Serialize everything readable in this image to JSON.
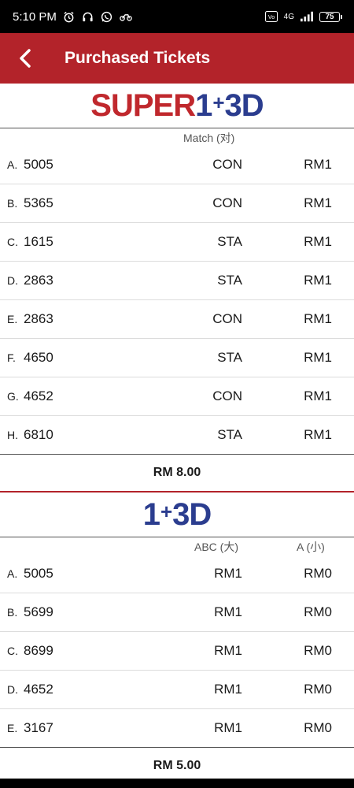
{
  "status_bar": {
    "time": "5:10 PM",
    "network": "4G",
    "battery": "75",
    "icons": [
      "alarm-icon",
      "headset-icon",
      "whatsapp-icon",
      "bike-icon",
      "volte-icon",
      "signal-icon"
    ]
  },
  "app_bar": {
    "title": "Purchased Tickets",
    "back_icon": "chevron-left-icon"
  },
  "super_section": {
    "logo": {
      "super": "SUPER",
      "one": "1",
      "plus": "+",
      "three_d": "3D"
    },
    "header": {
      "match": "Match (对)"
    },
    "rows": [
      {
        "letter": "A.",
        "number": "5005",
        "bet": "CON",
        "amount": "RM1"
      },
      {
        "letter": "B.",
        "number": "5365",
        "bet": "CON",
        "amount": "RM1"
      },
      {
        "letter": "C.",
        "number": "1615",
        "bet": "STA",
        "amount": "RM1"
      },
      {
        "letter": "D.",
        "number": "2863",
        "bet": "STA",
        "amount": "RM1"
      },
      {
        "letter": "E.",
        "number": "2863",
        "bet": "CON",
        "amount": "RM1"
      },
      {
        "letter": "F.",
        "number": "4650",
        "bet": "STA",
        "amount": "RM1"
      },
      {
        "letter": "G.",
        "number": "4652",
        "bet": "CON",
        "amount": "RM1"
      },
      {
        "letter": "H.",
        "number": "6810",
        "bet": "STA",
        "amount": "RM1"
      }
    ],
    "total": "RM 8.00"
  },
  "plain_section": {
    "logo": {
      "one": "1",
      "plus": "+",
      "three_d": "3D"
    },
    "header": {
      "abc": "ABC (大)",
      "a": "A (小)"
    },
    "rows": [
      {
        "letter": "A.",
        "number": "5005",
        "abc": "RM1",
        "a": "RM0"
      },
      {
        "letter": "B.",
        "number": "5699",
        "abc": "RM1",
        "a": "RM0"
      },
      {
        "letter": "C.",
        "number": "8699",
        "abc": "RM1",
        "a": "RM0"
      },
      {
        "letter": "D.",
        "number": "4652",
        "abc": "RM1",
        "a": "RM0"
      },
      {
        "letter": "E.",
        "number": "3167",
        "abc": "RM1",
        "a": "RM0"
      }
    ],
    "total": "RM 5.00"
  },
  "colors": {
    "brand_red": "#b3232a",
    "logo_red": "#c0282d",
    "logo_blue": "#2b3d8f"
  }
}
